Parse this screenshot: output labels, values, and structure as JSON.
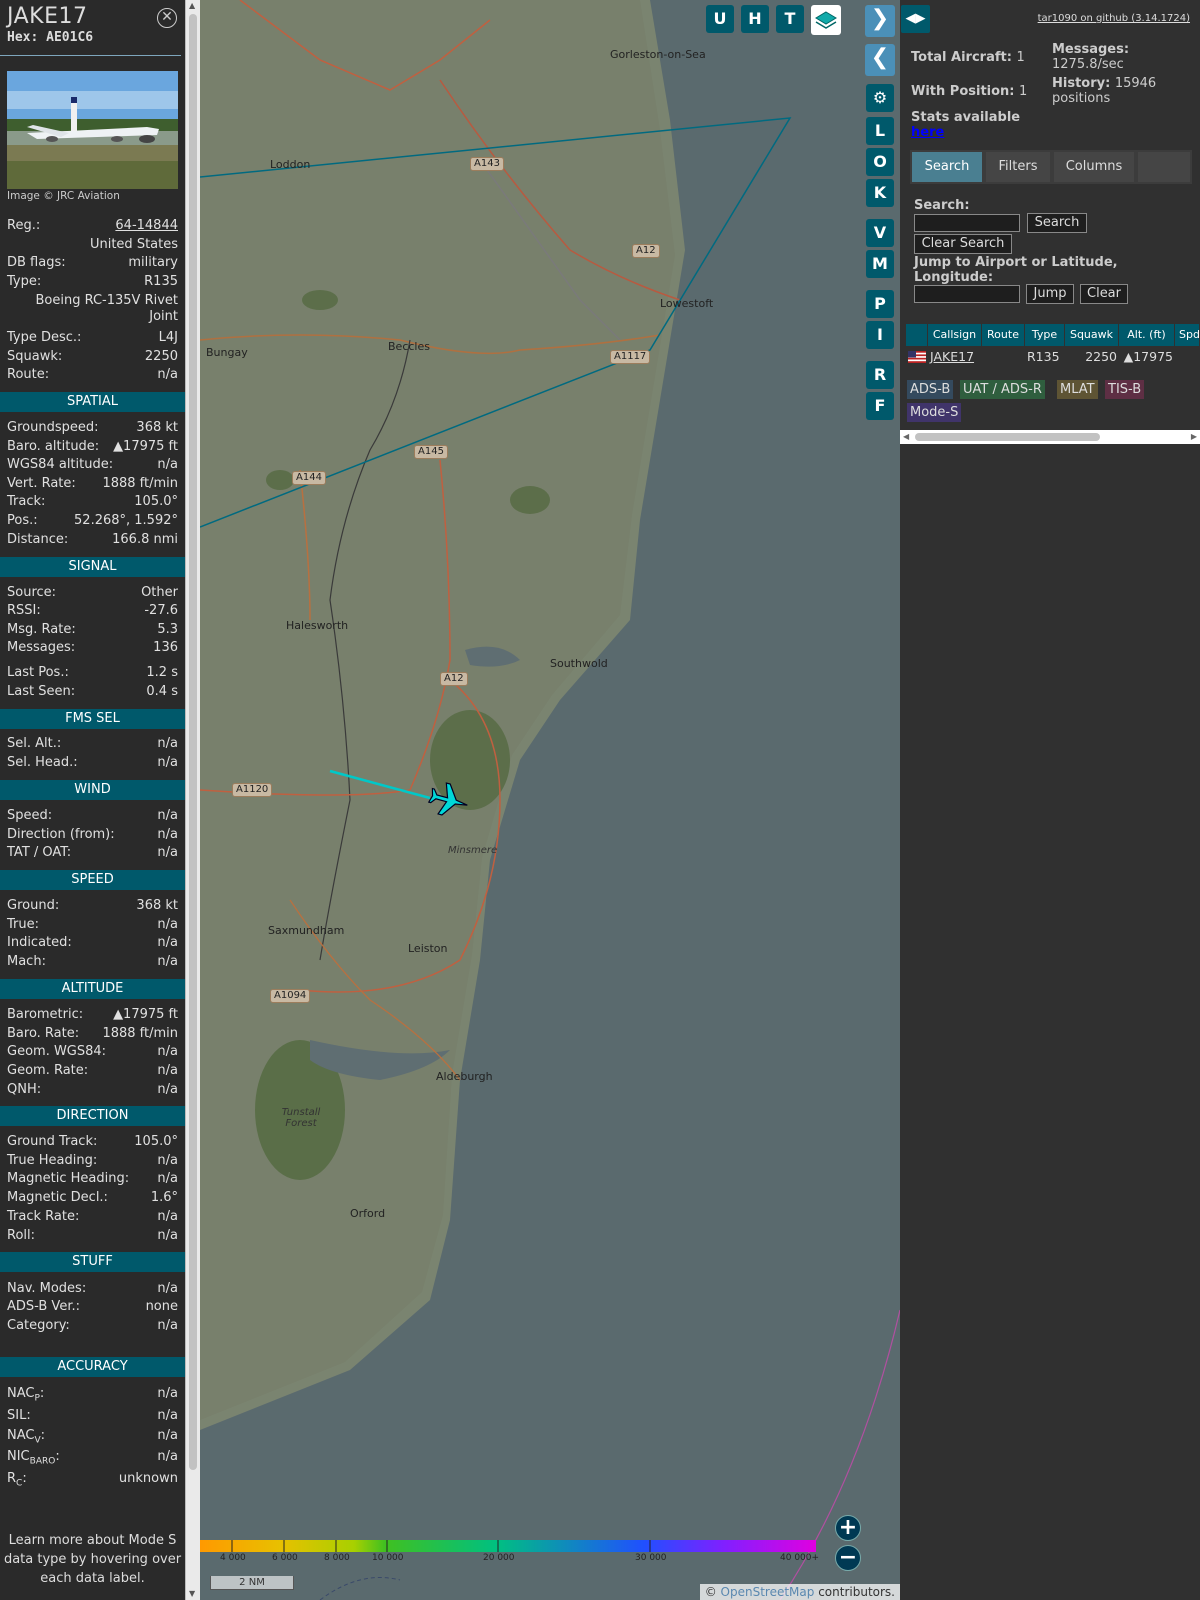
{
  "aircraft": {
    "callsign": "JAKE17",
    "hex_label": "Hex:",
    "hex": "AE01C6",
    "photo_credit": "Image © JRC Aviation"
  },
  "details": [
    {
      "label": "Reg.:",
      "value": "64-14844"
    },
    {
      "label": "",
      "value": "United States"
    },
    {
      "label": "DB flags:",
      "value": "military"
    },
    {
      "label": "Type:",
      "value": "R135"
    },
    {
      "label": "",
      "value": "Boeing RC-135V Rivet Joint"
    },
    {
      "label": "Type Desc.:",
      "value": "L4J"
    },
    {
      "label": "Squawk:",
      "value": "2250"
    },
    {
      "label": "Route:",
      "value": "n/a"
    }
  ],
  "sections": {
    "spatial": {
      "title": "SPATIAL",
      "rows": [
        {
          "label": "Groundspeed:",
          "value": "368 kt"
        },
        {
          "label": "Baro. altitude:",
          "value": "▲17975 ft"
        },
        {
          "label": "WGS84 altitude:",
          "value": "n/a"
        },
        {
          "label": "Vert. Rate:",
          "value": "1888 ft/min"
        },
        {
          "label": "Track:",
          "value": "105.0°"
        },
        {
          "label": "Pos.:",
          "value": "52.268°, 1.592°"
        },
        {
          "label": "Distance:",
          "value": "166.8 nmi"
        }
      ]
    },
    "signal": {
      "title": "SIGNAL",
      "rows": [
        {
          "label": "Source:",
          "value": "Other"
        },
        {
          "label": "RSSI:",
          "value": "-27.6"
        },
        {
          "label": "Msg. Rate:",
          "value": "5.3"
        },
        {
          "label": "Messages:",
          "value": "136"
        },
        {
          "label": "Last Pos.:",
          "value": "1.2 s"
        },
        {
          "label": "Last Seen:",
          "value": "0.4 s"
        }
      ]
    },
    "fms": {
      "title": "FMS SEL",
      "rows": [
        {
          "label": "Sel. Alt.:",
          "value": "n/a"
        },
        {
          "label": "Sel. Head.:",
          "value": "n/a"
        }
      ]
    },
    "wind": {
      "title": "WIND",
      "rows": [
        {
          "label": "Speed:",
          "value": "n/a"
        },
        {
          "label": "Direction (from):",
          "value": "n/a"
        },
        {
          "label": "TAT / OAT:",
          "value": "n/a"
        }
      ]
    },
    "speed": {
      "title": "SPEED",
      "rows": [
        {
          "label": "Ground:",
          "value": "368 kt"
        },
        {
          "label": "True:",
          "value": "n/a"
        },
        {
          "label": "Indicated:",
          "value": "n/a"
        },
        {
          "label": "Mach:",
          "value": "n/a"
        }
      ]
    },
    "altitude": {
      "title": "ALTITUDE",
      "rows": [
        {
          "label": "Barometric:",
          "value": "▲17975 ft"
        },
        {
          "label": "Baro. Rate:",
          "value": "1888 ft/min"
        },
        {
          "label": "Geom. WGS84:",
          "value": "n/a"
        },
        {
          "label": "Geom. Rate:",
          "value": "n/a"
        },
        {
          "label": "QNH:",
          "value": "n/a"
        }
      ]
    },
    "direction": {
      "title": "DIRECTION",
      "rows": [
        {
          "label": "Ground Track:",
          "value": "105.0°"
        },
        {
          "label": "True Heading:",
          "value": "n/a"
        },
        {
          "label": "Magnetic Heading:",
          "value": "n/a"
        },
        {
          "label": "Magnetic Decl.:",
          "value": "1.6°"
        },
        {
          "label": "Track Rate:",
          "value": "n/a"
        },
        {
          "label": "Roll:",
          "value": "n/a"
        }
      ]
    },
    "stuff": {
      "title": "STUFF",
      "rows": [
        {
          "label": "Nav. Modes:",
          "value": "n/a"
        },
        {
          "label": "ADS-B Ver.:",
          "value": "none"
        },
        {
          "label": "Category:",
          "value": "n/a"
        }
      ]
    },
    "accuracy": {
      "title": "ACCURACY",
      "rows": [
        {
          "label": "NAC",
          "sub": "P",
          "value": "n/a"
        },
        {
          "label": "SIL:",
          "sub": "",
          "value": "n/a"
        },
        {
          "label": "NAC",
          "sub": "V",
          "value": "n/a"
        },
        {
          "label": "NIC",
          "sub": "BARO",
          "value": "n/a"
        },
        {
          "label": "R",
          "sub": "C",
          "value": "unknown"
        }
      ]
    }
  },
  "footnote": "Learn more about Mode S data type by hovering over each data label.",
  "map": {
    "buttons_top": [
      "U",
      "H",
      "T"
    ],
    "side_buttons": [
      "L",
      "O",
      "K",
      "V",
      "M",
      "P",
      "I",
      "R",
      "F"
    ],
    "places": [
      "Gorleston-on-Sea",
      "Loddon",
      "Lowestoft",
      "Bungay",
      "Beccles",
      "Halesworth",
      "Southwold",
      "Saxmundham",
      "Leiston",
      "Aldeburgh",
      "Orford",
      "Minsmere",
      "Tunstall Forest"
    ],
    "roads": [
      "A143",
      "A12",
      "A1117",
      "A145",
      "A144",
      "A12",
      "A1120",
      "A1094"
    ],
    "altitude_ticks": [
      "4 000",
      "6 000",
      "8 000",
      "10 000",
      "20 000",
      "30 000",
      "40 000+"
    ],
    "scale": "2 NM",
    "attribution_prefix": "©",
    "attribution_link": "OpenStreetMap",
    "attribution_suffix": "contributors.",
    "zoom_in": "+",
    "zoom_out": "−"
  },
  "right": {
    "github": "tar1090 on github (3.14.1724)",
    "total_label": "Total Aircraft:",
    "total": "1",
    "with_pos_label": "With Position:",
    "with_pos": "1",
    "messages_label": "Messages:",
    "messages": "1275.8/sec",
    "history_label": "History:",
    "history": "15946 positions",
    "stats_label": "Stats available",
    "stats_link": "here",
    "tabs": [
      "Search",
      "Filters",
      "Columns"
    ],
    "search_label": "Search:",
    "search_button": "Search",
    "clear_search": "Clear Search",
    "jump_label": "Jump to Airport or Latitude, Longitude:",
    "jump_button": "Jump",
    "clear_button": "Clear",
    "columns": [
      "Callsign",
      "Route",
      "Type",
      "Squawk",
      "Alt. (ft)",
      "Spd"
    ],
    "row": {
      "callsign": "JAKE17",
      "route": "",
      "type": "R135",
      "squawk": "2250",
      "alt": "▲17975"
    },
    "sources": [
      "ADS-B",
      "UAT / ADS-R",
      "MLAT",
      "TIS-B",
      "Mode-S"
    ]
  },
  "colors": {
    "accent": "#00596b",
    "track": "#00c8c8",
    "range_ring": "#006a80"
  }
}
